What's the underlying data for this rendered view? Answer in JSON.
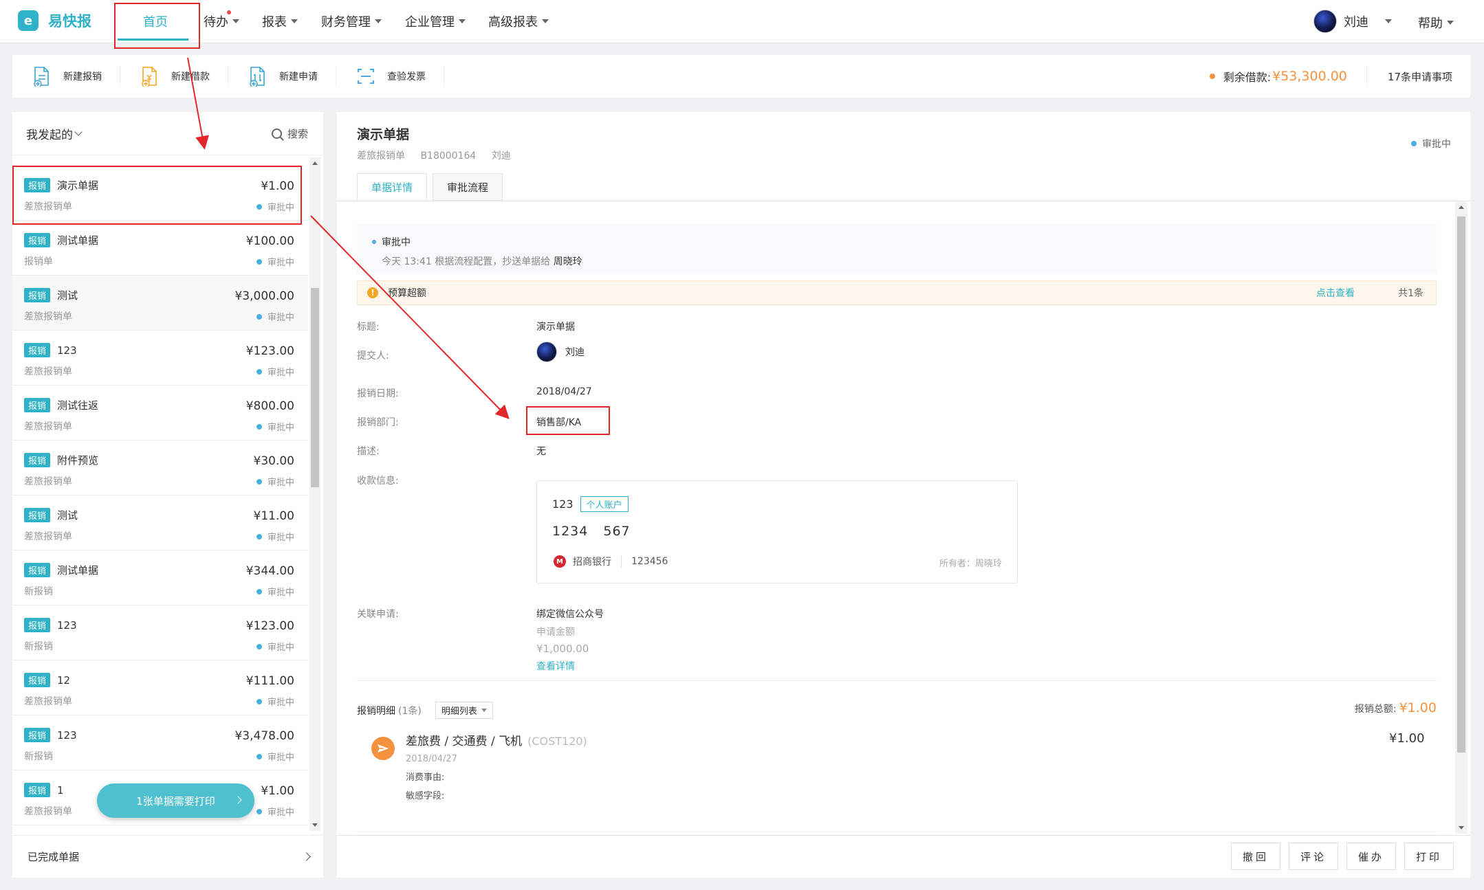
{
  "nav": {
    "logo_glyph": "e",
    "logo_text": "易快报",
    "items": [
      {
        "label": "首页"
      },
      {
        "label": "待办"
      },
      {
        "label": "报表"
      },
      {
        "label": "财务管理"
      },
      {
        "label": "企业管理"
      },
      {
        "label": "高级报表"
      }
    ],
    "user_name": "刘迪",
    "help": "帮助"
  },
  "toolbar": {
    "items": [
      {
        "label": "新建报销",
        "icon": "doc-add-icon"
      },
      {
        "label": "新建借款",
        "icon": "loan-icon"
      },
      {
        "label": "新建申请",
        "icon": "apply-icon"
      },
      {
        "label": "查验发票",
        "icon": "scan-icon"
      }
    ],
    "balance_label": "剩余借款:",
    "balance_amount": "¥53,300.00",
    "requests": "17条申请事项"
  },
  "left": {
    "title": "我发起的",
    "search": "搜索",
    "tag_label": "报销",
    "status_label": "审批中",
    "rows": [
      {
        "title": "演示单据",
        "sub": "差旅报销单",
        "amount": "¥1.00"
      },
      {
        "title": "测试单据",
        "sub": "报销单",
        "amount": "¥100.00"
      },
      {
        "title": "测试",
        "sub": "差旅报销单",
        "amount": "¥3,000.00"
      },
      {
        "title": "123",
        "sub": "差旅报销单",
        "amount": "¥123.00"
      },
      {
        "title": "测试往返",
        "sub": "差旅报销单",
        "amount": "¥800.00"
      },
      {
        "title": "附件预览",
        "sub": "差旅报销单",
        "amount": "¥30.00"
      },
      {
        "title": "测试",
        "sub": "差旅报销单",
        "amount": "¥11.00"
      },
      {
        "title": "测试单据",
        "sub": "新报销",
        "amount": "¥344.00"
      },
      {
        "title": "123",
        "sub": "新报销",
        "amount": "¥123.00"
      },
      {
        "title": "12",
        "sub": "差旅报销单",
        "amount": "¥111.00"
      },
      {
        "title": "123",
        "sub": "新报销",
        "amount": "¥3,478.00"
      },
      {
        "title": "1",
        "sub": "差旅报销单",
        "amount": "¥1.00"
      }
    ],
    "print_prompt": "1张单据需要打印",
    "completed": "已完成单据"
  },
  "detail": {
    "title": "演示单据",
    "type": "差旅报销单",
    "code": "B18000164",
    "owner": "刘迪",
    "status": "审批中",
    "tabs": [
      "单据详情",
      "审批流程"
    ],
    "flow_status": "审批中",
    "flow_note_prefix": "今天 13:41   根据流程配置，抄送单据给",
    "flow_note_name": "周晓玲",
    "budget_warning": "预算超额",
    "budget_link": "点击查看",
    "budget_count": "共1条",
    "fields": {
      "title_label": "标题:",
      "title_value": "演示单据",
      "submitter_label": "提交人:",
      "submitter_value": "刘迪",
      "date_label": "报销日期:",
      "date_value": "2018/04/27",
      "dept_label": "报销部门:",
      "dept_value": "销售部/KA",
      "desc_label": "描述:",
      "desc_value": "无",
      "payee_label": "收款信息:",
      "linked_label": "关联申请:"
    },
    "payee": {
      "name": "123",
      "badge": "个人账户",
      "account_a": "1234",
      "account_b": "567",
      "bank_glyph": "M",
      "bank": "招商银行",
      "branch": "123456",
      "holder": "所有者：周晓玲"
    },
    "linked": {
      "name": "绑定微信公众号",
      "amount_label": "申请金额",
      "amount": "¥1,000.00",
      "link": "查看详情"
    },
    "items_head": "报销明细",
    "items_count": "(1条)",
    "view_mode": "明细列表",
    "total_label": "报销总额:",
    "total_amount": "¥1.00",
    "expense": {
      "name": "差旅费 / 交通费 / 飞机",
      "code": "(COST120)",
      "date": "2018/04/27",
      "reason": "消费事由:",
      "sensitive": "敏感字段:",
      "amount": "¥1.00"
    },
    "actions": [
      "撤回",
      "评论",
      "催办",
      "打印"
    ]
  },
  "colors": {
    "brand": "#2fb2c7",
    "orange": "#f5923e",
    "annotation_red": "#e3262a",
    "status_blue": "#4aaee3"
  }
}
